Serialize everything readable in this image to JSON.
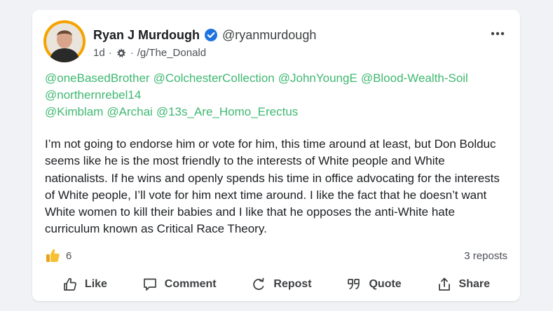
{
  "post": {
    "author_name": "Ryan J Murdough",
    "author_handle": "@ryanmurdough",
    "age": "1d",
    "group": "/g/The_Donald",
    "separator": "·",
    "mentions_line1": [
      "@oneBasedBrother",
      "@ColchesterCollection",
      "@JohnYoungE",
      "@Blood-Wealth-Soil"
    ],
    "mentions_line2": [
      "@northernrebel14"
    ],
    "mentions_line3": [
      "@Kimblam",
      "@Archai",
      "@13s_Are_Homo_Erectus"
    ],
    "body": "I’m not going to endorse him or vote for him, this time around at least, but Don Bolduc seems like he is the most friendly to the interests of White people and White nationalists. If he wins and openly spends his time in office advocating for the interests of White people, I’ll vote for him next time around. I like the fact that he doesn’t want White women to kill their babies and I like that he opposes the anti-White hate curriculum known as Critical Race Theory.",
    "like_count": "6",
    "reposts_label": "3 reposts"
  },
  "actions": {
    "like": "Like",
    "comment": "Comment",
    "repost": "Repost",
    "quote": "Quote",
    "share": "Share"
  },
  "icons": {
    "verified": "verified-badge-icon",
    "group": "group-icon",
    "more": "more-options-icon",
    "like_reaction": "thumbs-up-emoji-icon"
  },
  "colors": {
    "mention": "#3fb871",
    "verified": "#1d74e0",
    "avatar_ring": "#f5a300",
    "background": "#f0f2f5"
  }
}
